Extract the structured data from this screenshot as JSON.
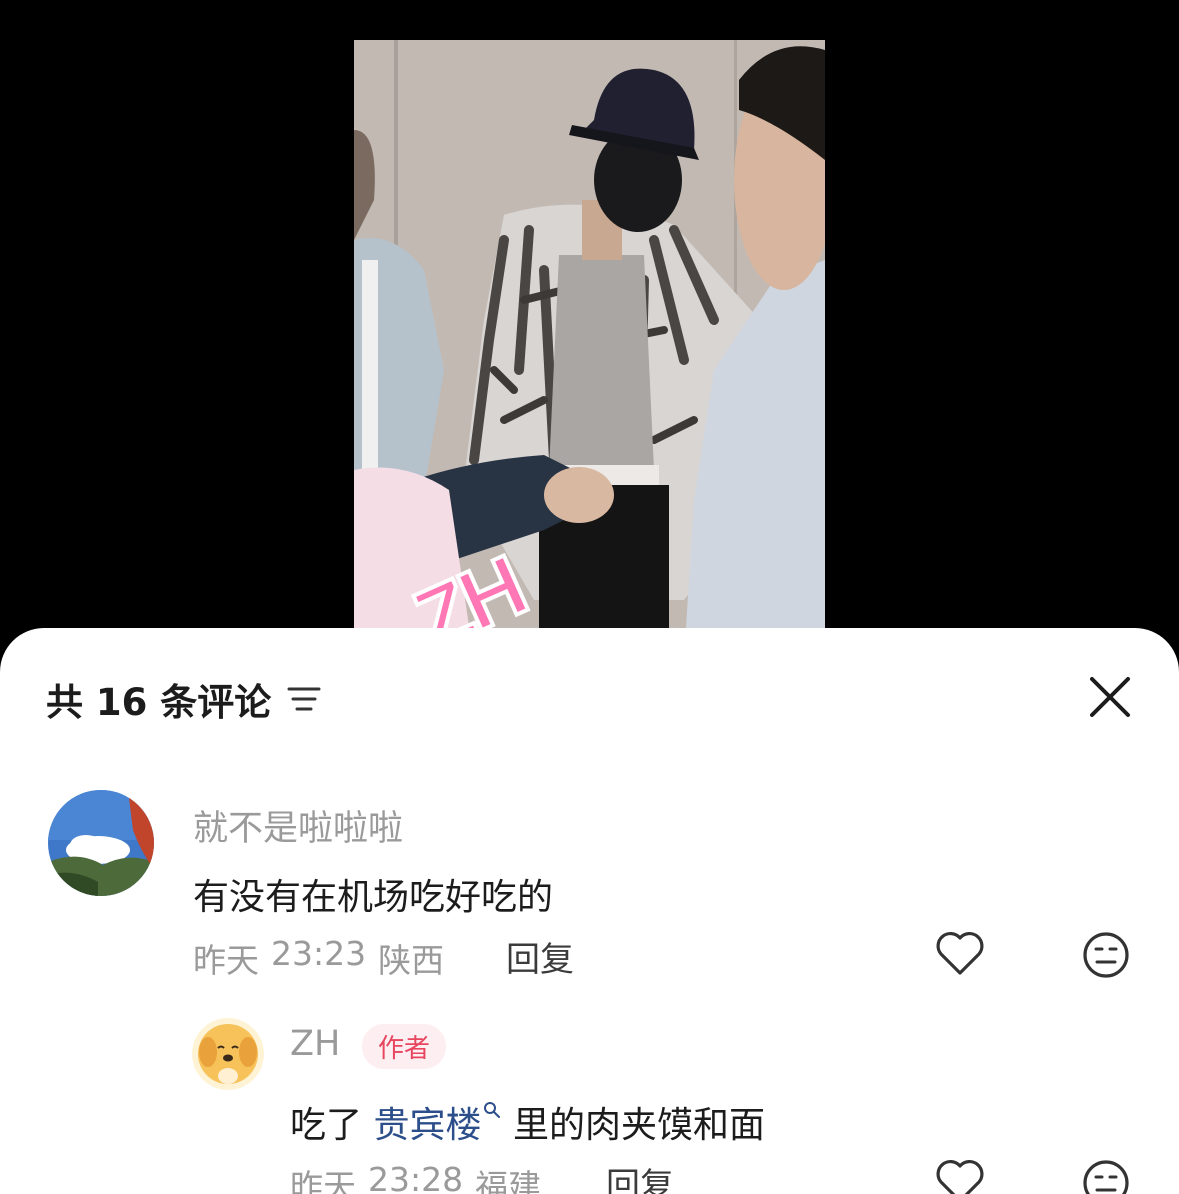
{
  "video": {
    "watermark": "ZH"
  },
  "comments_panel": {
    "count_label": "共 16 条评论",
    "comments": [
      {
        "username": "就不是啦啦啦",
        "text": "有没有在机场吃好吃的",
        "date": "昨天",
        "time": "23:23",
        "location": "陕西",
        "reply_label": "回复"
      }
    ],
    "replies": [
      {
        "username": "ZH",
        "badge": "作者",
        "text_before": "吃了",
        "topic": "贵宾楼",
        "text_after": "里的肉夹馍和面",
        "date": "昨天",
        "time": "23:28",
        "location": "福建",
        "reply_label": "回复"
      }
    ]
  },
  "icons": [
    "sort-icon",
    "close-icon",
    "heart-icon",
    "meh-face-icon",
    "search-icon"
  ]
}
